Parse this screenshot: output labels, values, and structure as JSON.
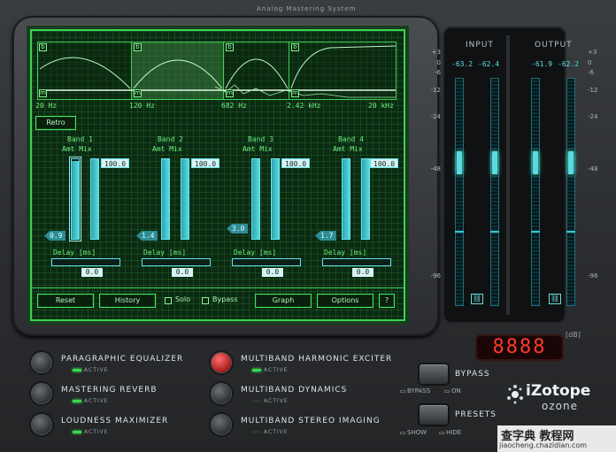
{
  "app": {
    "title": "Analog Mastering System"
  },
  "spectrum": {
    "freq_labels": [
      "20 Hz",
      "120 Hz",
      "682 Hz",
      "2.42 kHz",
      "20 kHz"
    ],
    "band_marker_top": "b",
    "band_marker_bottom": "m"
  },
  "retro_button": "Retro",
  "bands": [
    {
      "name": "Band 1",
      "amt_mix": "Amt  Mix",
      "mix_value": "100.0",
      "amt_value": "0.9",
      "amt_level": 0.98,
      "mix_level": 1.0,
      "delay_label": "Delay [ms]",
      "delay_value": "0.0"
    },
    {
      "name": "Band 2",
      "amt_mix": "Amt  Mix",
      "mix_value": "100.0",
      "amt_value": "1.4",
      "amt_level": 1.0,
      "mix_level": 1.0,
      "delay_label": "Delay [ms]",
      "delay_value": "0.0"
    },
    {
      "name": "Band 3",
      "amt_mix": "Amt  Mix",
      "mix_value": "100.0",
      "amt_value": "3.0",
      "amt_level": 1.0,
      "mix_level": 1.0,
      "delay_label": "Delay [ms]",
      "delay_value": "0.0"
    },
    {
      "name": "Band 4",
      "amt_mix": "Amt  Mix",
      "mix_value": "100.0",
      "amt_value": "1.7",
      "amt_level": 1.0,
      "mix_level": 1.0,
      "delay_label": "Delay [ms]",
      "delay_value": "0.0"
    }
  ],
  "screen_bar": {
    "reset": "Reset",
    "history": "History",
    "solo": "Solo",
    "bypass": "Bypass",
    "graph": "Graph",
    "options": "Options",
    "help": "?"
  },
  "meters": {
    "input_label": "INPUT",
    "output_label": "OUTPUT",
    "input_peaks": [
      "-63.2",
      "-62.4"
    ],
    "output_peaks": [
      "-61.9",
      "-62.2"
    ],
    "scale": [
      "+3",
      "0",
      "-6",
      "-12",
      "-24",
      "-48",
      "-96"
    ],
    "link_icon": "link-icon"
  },
  "display": {
    "value": "8888",
    "unit": "[dB]"
  },
  "modules_left": [
    {
      "name": "PARAGRAPHIC EQUALIZER",
      "active_label": "ACTIVE",
      "active": true,
      "selected": false
    },
    {
      "name": "MASTERING REVERB",
      "active_label": "ACTIVE",
      "active": true,
      "selected": false
    },
    {
      "name": "LOUDNESS MAXIMIZER",
      "active_label": "ACTIVE",
      "active": true,
      "selected": false
    }
  ],
  "modules_right": [
    {
      "name": "MULTIBAND HARMONIC EXCITER",
      "active_label": "ACTIVE",
      "active": true,
      "selected": true
    },
    {
      "name": "MULTIBAND DYNAMICS",
      "active_label": "ACTIVE",
      "active": false,
      "selected": false
    },
    {
      "name": "MULTIBAND STEREO IMAGING",
      "active_label": "ACTIVE",
      "active": false,
      "selected": false
    }
  ],
  "bypass": {
    "label": "BYPASS",
    "sub_left": "BYPASS",
    "sub_right": "ON"
  },
  "presets": {
    "label": "PRESETS",
    "sub_left": "SHOW",
    "sub_right": "HIDE"
  },
  "logo": {
    "main": "iZotope",
    "sub": "ozone"
  },
  "watermark": {
    "line1": "查字典 教程网",
    "line2": "jiaocheng.chazidian.com"
  }
}
